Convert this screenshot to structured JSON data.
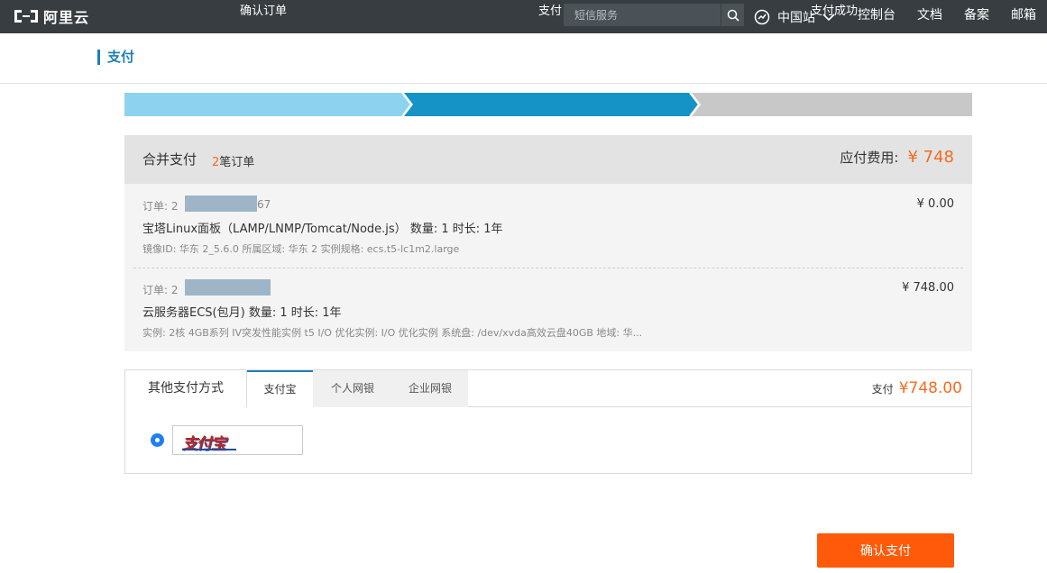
{
  "nav": {
    "logo_text": "阿里云",
    "search_placeholder": "短信服务",
    "region": "中国站",
    "links": [
      "控制台",
      "文档",
      "备案",
      "邮箱"
    ]
  },
  "page": {
    "title": "支付"
  },
  "steps": [
    "确认订单",
    "支付",
    "支付成功"
  ],
  "summary": {
    "title": "合并支付",
    "order_count": "2",
    "order_count_suffix": "笔订单",
    "fee_label": "应付费用:",
    "fee_amount": "¥ 748"
  },
  "orders": [
    {
      "no_label": "订单:",
      "no_prefix": "2",
      "no_suffix": "67",
      "name": "宝塔Linux面板（LAMP/LNMP/Tomcat/Node.js） 数量: 1 时长: 1年",
      "spec": "镜像ID: 华东 2_5.6.0 所属区域: 华东 2 实例规格: ecs.t5-lc1m2.large",
      "price": "¥ 0.00"
    },
    {
      "no_label": "订单:",
      "no_prefix": "2",
      "no_suffix": "",
      "name": "云服务器ECS(包月) 数量: 1 时长: 1年",
      "spec": "实例: 2核 4GB系列 IV突发性能实例 t5 I/O 优化实例: I/O 优化实例 系统盘: /dev/xvda高效云盘40GB 地域: 华...",
      "price": "¥ 748.00"
    }
  ],
  "payment": {
    "label": "其他支付方式",
    "tabs": [
      "支付宝",
      "个人网银",
      "企业网银"
    ],
    "total_label": "支付",
    "total_amount": "¥748.00",
    "alipay_logo_text": "支付宝"
  },
  "confirm_label": "确认支付",
  "colors": {
    "accent": "#1e80b4",
    "orange": "#f56b1f",
    "step_done": "#8dd3f0",
    "step_active": "#1593c7",
    "step_todo": "#c8c8c8",
    "button": "#ff5a0a"
  }
}
